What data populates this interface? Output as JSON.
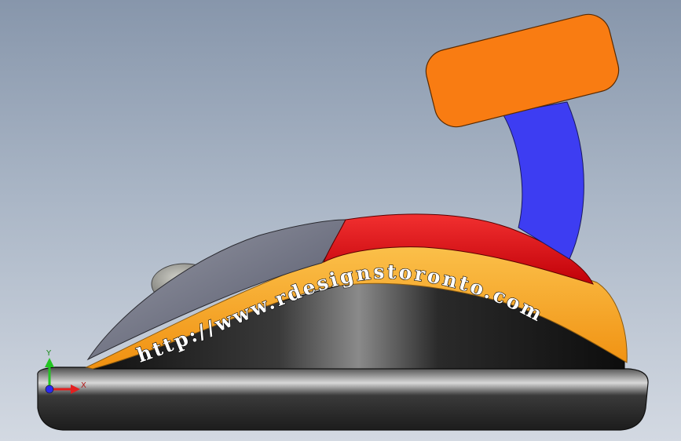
{
  "scene": {
    "engraving_text": "http://www.rdesignstoronto.com",
    "colors": {
      "background_top": "#8796ab",
      "background_bottom": "#d3d9e2",
      "handle_pad": "#f97c12",
      "stem": "#3d3df2",
      "top_shell_red": "#df0d0f",
      "band_orange": "#f6a422",
      "upper_shell_grey": "#6d7080",
      "body_black": "#141414",
      "base_dark": "#2c2c2c",
      "scroll_wheel": "#8a8a85"
    }
  },
  "triad": {
    "x_label": "X",
    "y_label": "Y",
    "x_color": "#e32020",
    "y_color": "#22c422",
    "z_color": "#2a2af0"
  }
}
